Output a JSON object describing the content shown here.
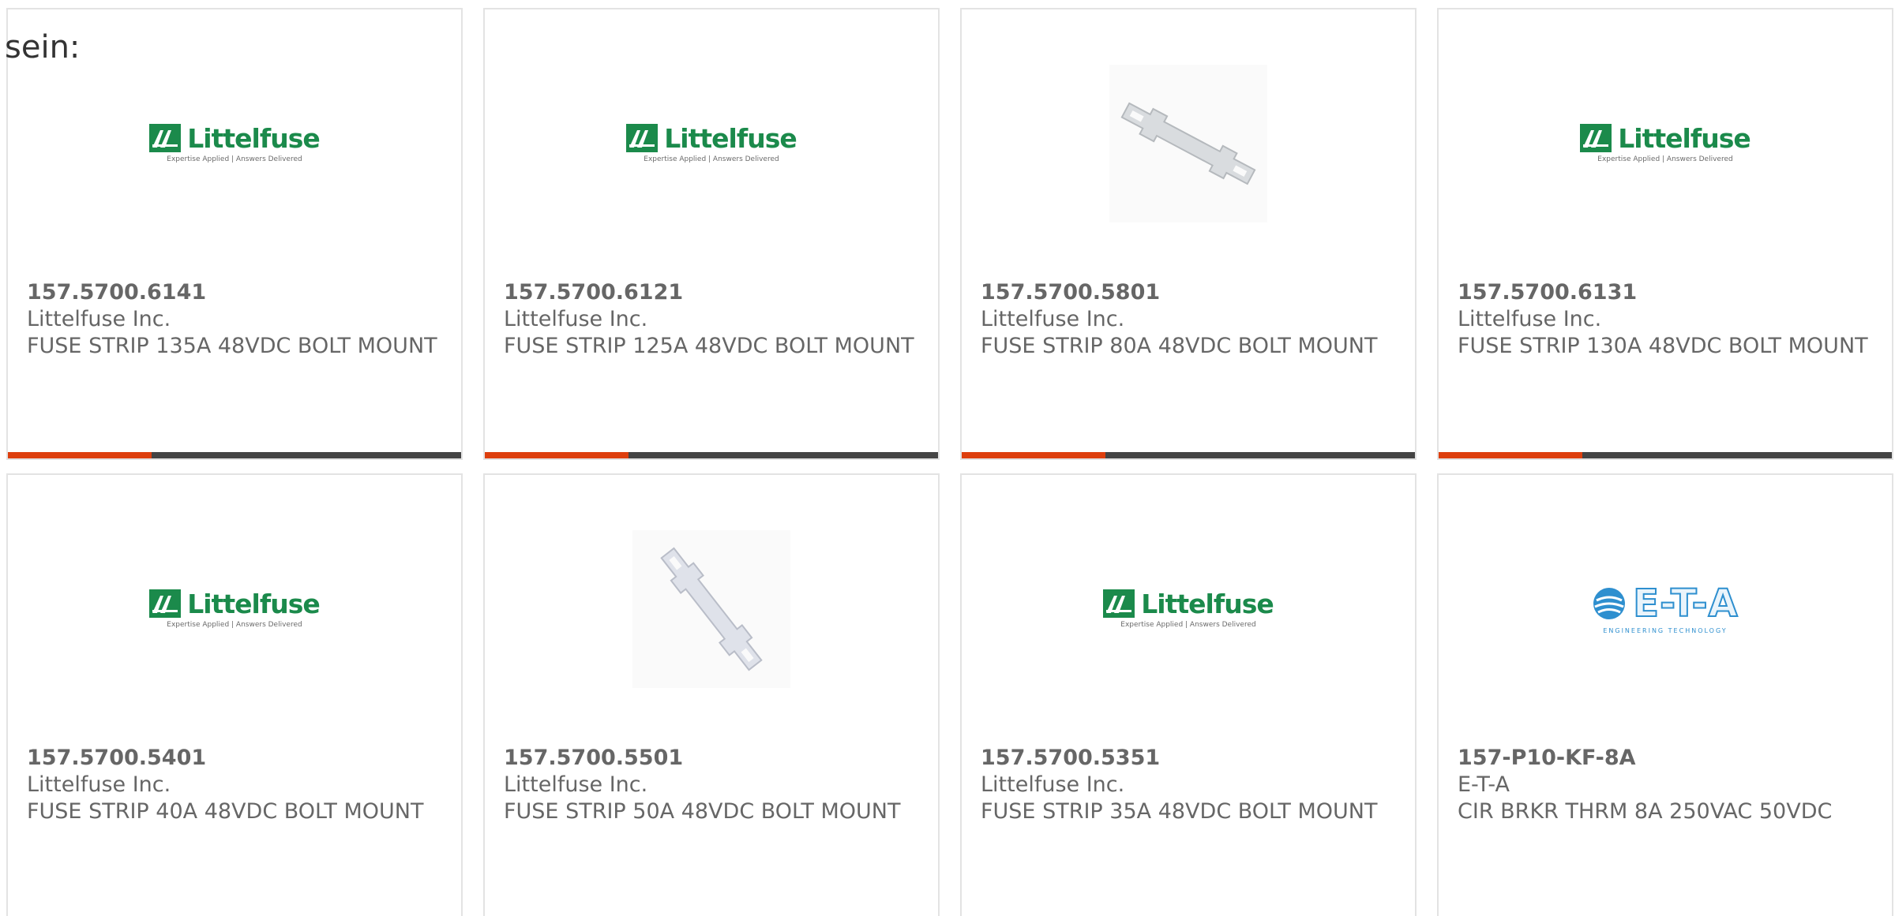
{
  "intro_text": "sein:",
  "logos": {
    "littelfuse": {
      "word": "Littelfuse",
      "tagline": "Expertise Applied | Answers Delivered"
    },
    "eta": {
      "word": "E-T-A",
      "tagline": "ENGINEERING TECHNOLOGY"
    }
  },
  "colors": {
    "accent": "#dd3f0e",
    "bar": "#444444",
    "littelfuse_green": "#1b8a4b",
    "eta_blue": "#2e8fcf"
  },
  "products": [
    {
      "part_number": "157.5700.6141",
      "manufacturer": "Littelfuse Inc.",
      "description": "FUSE STRIP 135A 48VDC BOLT MOUNT",
      "image": "littelfuse-logo"
    },
    {
      "part_number": "157.5700.6121",
      "manufacturer": "Littelfuse Inc.",
      "description": "FUSE STRIP 125A 48VDC BOLT MOUNT",
      "image": "littelfuse-logo"
    },
    {
      "part_number": "157.5700.5801",
      "manufacturer": "Littelfuse Inc.",
      "description": "FUSE STRIP 80A 48VDC BOLT MOUNT",
      "image": "fuse-strip-photo"
    },
    {
      "part_number": "157.5700.6131",
      "manufacturer": "Littelfuse Inc.",
      "description": "FUSE STRIP 130A 48VDC BOLT MOUNT",
      "image": "littelfuse-logo"
    },
    {
      "part_number": "157.5700.5401",
      "manufacturer": "Littelfuse Inc.",
      "description": "FUSE STRIP 40A 48VDC BOLT MOUNT",
      "image": "littelfuse-logo"
    },
    {
      "part_number": "157.5700.5501",
      "manufacturer": "Littelfuse Inc.",
      "description": "FUSE STRIP 50A 48VDC BOLT MOUNT",
      "image": "fuse-strip-photo"
    },
    {
      "part_number": "157.5700.5351",
      "manufacturer": "Littelfuse Inc.",
      "description": "FUSE STRIP 35A 48VDC BOLT MOUNT",
      "image": "littelfuse-logo"
    },
    {
      "part_number": "157-P10-KF-8A",
      "manufacturer": "E-T-A",
      "description": "CIR BRKR THRM 8A 250VAC 50VDC",
      "image": "eta-logo"
    }
  ]
}
